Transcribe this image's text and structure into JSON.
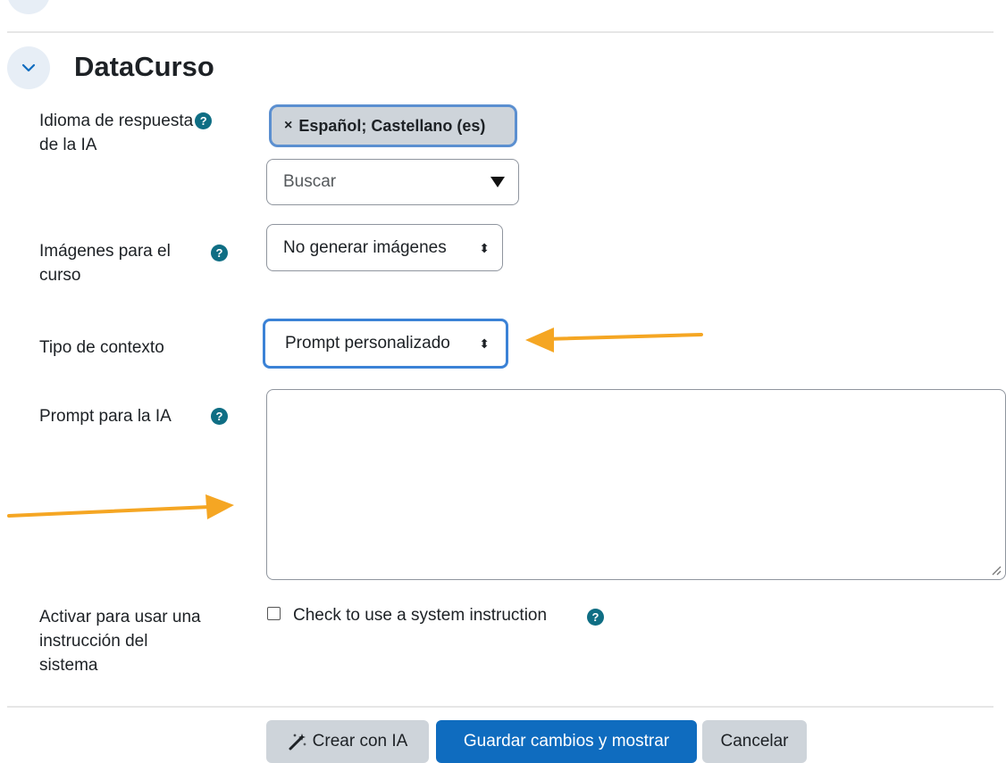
{
  "section": {
    "title": "DataCurso"
  },
  "fields": {
    "language": {
      "label_line1": "Idioma de respuesta",
      "label_line2": "de la IA",
      "selected_chip": "Español; Castellano (es)",
      "search_placeholder": "Buscar"
    },
    "images": {
      "label_line1": "Imágenes para el",
      "label_line2": "curso",
      "value": "No generar imágenes"
    },
    "context_type": {
      "label": "Tipo de contexto",
      "value": "Prompt personalizado"
    },
    "prompt": {
      "label": "Prompt para la IA",
      "value": ""
    },
    "system_instruction": {
      "label_line1": "Activar para usar una",
      "label_line2": "instrucción del",
      "label_line3": "sistema",
      "checkbox_label": "Check to use a system instruction",
      "checked": false
    }
  },
  "buttons": {
    "create_ai": "Crear con IA",
    "save": "Guardar cambios y mostrar",
    "cancel": "Cancelar"
  },
  "help_icon_glyph": "?",
  "colors": {
    "primary": "#0f6cbf",
    "help": "#0f6e84",
    "annotation_arrow": "#f5a623"
  }
}
